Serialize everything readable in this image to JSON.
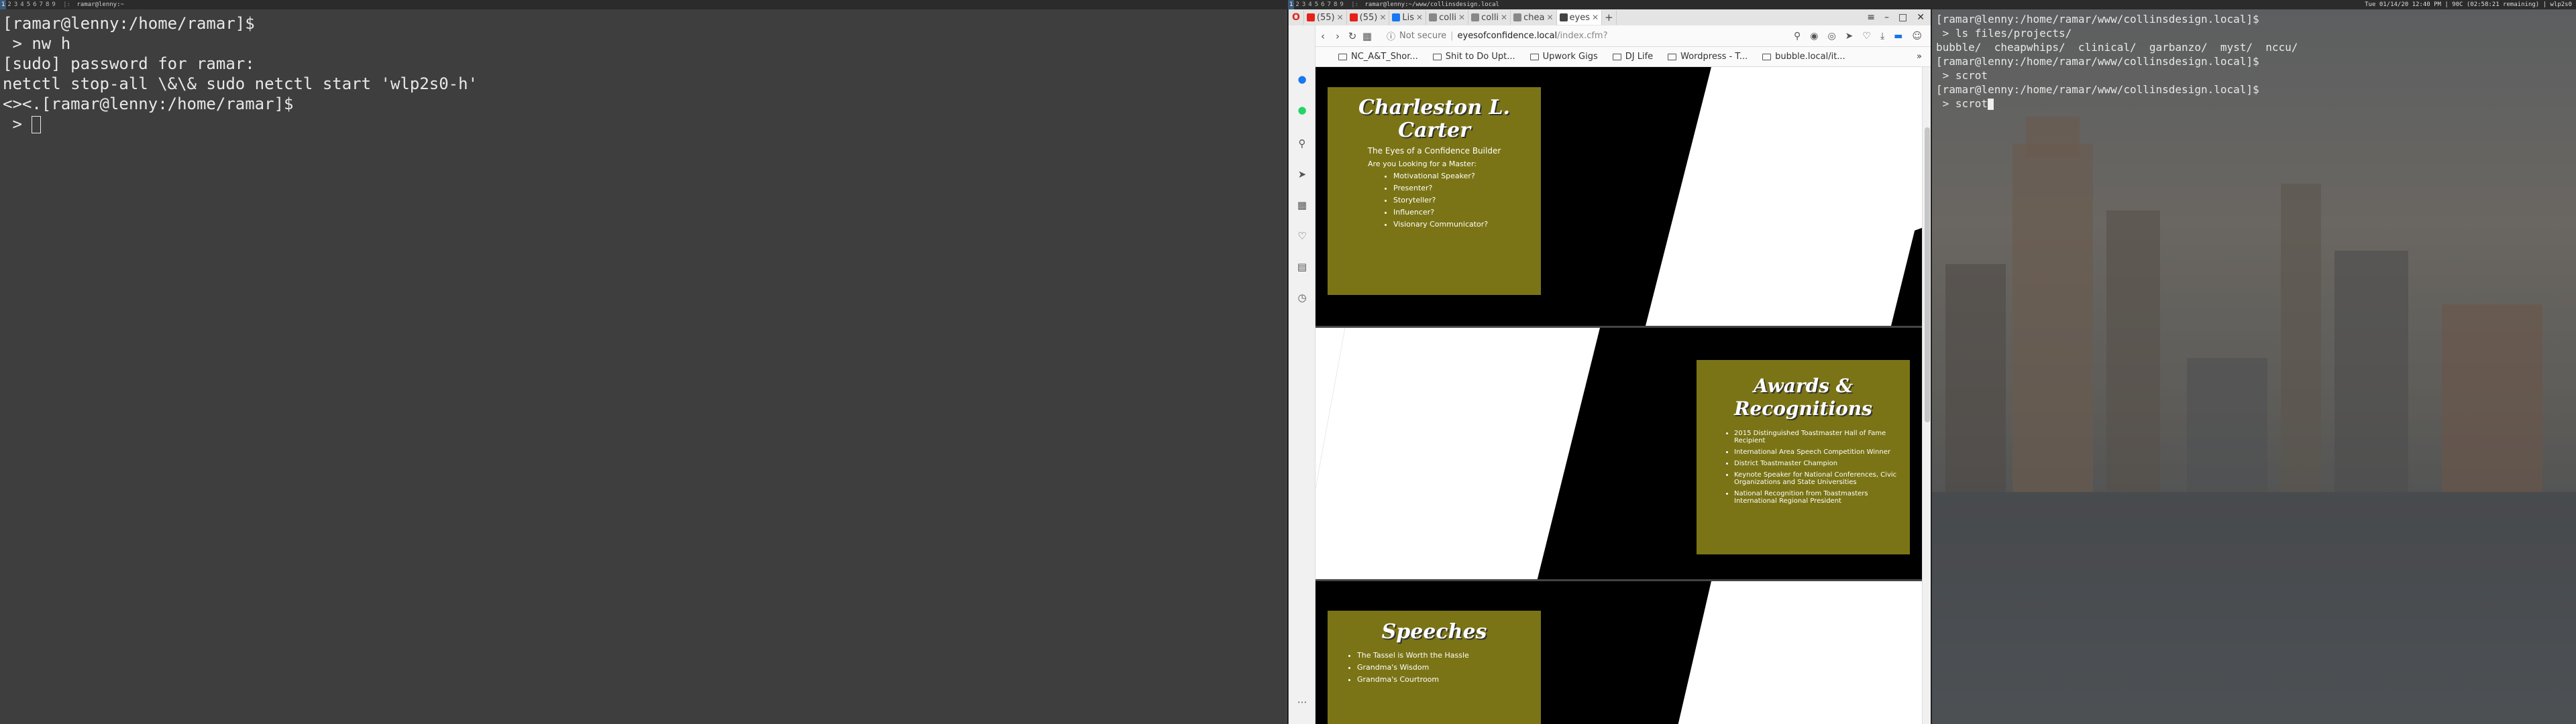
{
  "wm_left": {
    "workspaces": [
      "1",
      "2",
      "3",
      "4",
      "5",
      "6",
      "7",
      "8",
      "9"
    ],
    "title": "ramar@lenny:~"
  },
  "wm_right": {
    "workspaces": [
      "1",
      "2",
      "3",
      "4",
      "5",
      "6",
      "7",
      "8",
      "9"
    ],
    "title": "ramar@lenny:~/www/collinsdesign.local",
    "status": "Tue 01/14/20 12:40 PM | 90C (02:58:21 remaining) | wlp2s0"
  },
  "left_terminal": {
    "lines": [
      "[ramar@lenny:/home/ramar]$",
      " > nw h",
      "[sudo] password for ramar:",
      "netctl stop-all \\&\\& sudo netctl start 'wlp2s0-h'",
      "<><.[ramar@lenny:/home/ramar]$"
    ],
    "prompt": " > "
  },
  "right_terminal": {
    "lines": [
      "[ramar@lenny:/home/ramar/www/collinsdesign.local]$",
      " > ls files/projects/",
      "bubble/  cheapwhips/  clinical/  garbanzo/  myst/  nccu/",
      "[ramar@lenny:/home/ramar/www/collinsdesign.local]$",
      " > scrot",
      "[ramar@lenny:/home/ramar/www/collinsdesign.local]$"
    ],
    "prompt": " > scrot"
  },
  "browser": {
    "tabs": [
      {
        "label": "(55)",
        "color": "#e62117"
      },
      {
        "label": "(55)",
        "color": "#e62117"
      },
      {
        "label": "Lis",
        "color": "#1877f2"
      },
      {
        "label": "colli",
        "color": "#888888"
      },
      {
        "label": "colli",
        "color": "#888888"
      },
      {
        "label": "chea",
        "color": "#888888"
      },
      {
        "label": "eyes",
        "color": "#444444"
      }
    ],
    "new_tab": "+",
    "address": {
      "security": "Not secure",
      "host": "eyesofconfidence.local",
      "path": "/index.cfm?"
    },
    "bookmarks": [
      "NC_A&T_Shor...",
      "Shit to Do Upt...",
      "Upwork Gigs",
      "DJ Life",
      "Wordpress - T...",
      "bubble.local/it..."
    ],
    "more": "»"
  },
  "page": {
    "hero": {
      "title": "Charleston L. Carter",
      "subtitle": "The Eyes of a Confidence Builder",
      "lead": "Are you Looking for a Master:",
      "items": [
        "Motivational Speaker?",
        "Presenter?",
        "Storyteller?",
        "Influencer?",
        "Visionary Communicator?"
      ]
    },
    "awards": {
      "title": "Awards & Recognitions",
      "items": [
        "2015 Distinguished Toastmaster Hall of Fame Recipient",
        "International Area Speech Competition Winner",
        "District Toastmaster Champion",
        "Keynote Speaker for National Conferences, Civic Organizations and State Universities",
        "National Recognition from Toastmasters International Regional President"
      ]
    },
    "speeches": {
      "title": "Speeches",
      "items": [
        "The Tassel is Worth the Hassle",
        "Grandma's Wisdom",
        "Grandma's Courtroom"
      ]
    },
    "colors": {
      "panel": "#7a7416",
      "bg": "#000000",
      "stripe": "#ffffff"
    }
  }
}
